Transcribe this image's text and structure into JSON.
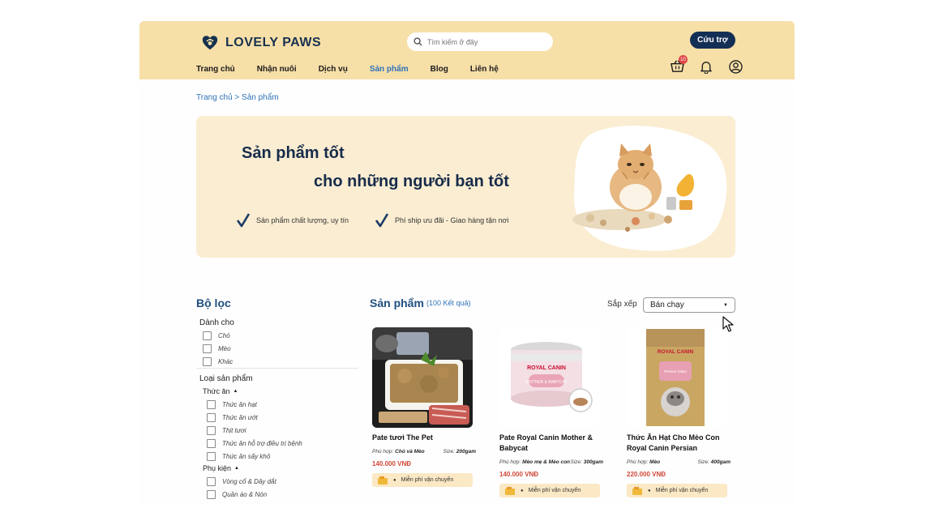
{
  "brand": {
    "name": "LOVELY PAWS"
  },
  "search": {
    "placeholder": "Tìm kiếm ở đây"
  },
  "header": {
    "support_label": "Cứu trợ",
    "cart_badge": "10"
  },
  "nav": [
    "Trang chủ",
    "Nhận nuôi",
    "Dịch vụ",
    "Sản phẩm",
    "Blog",
    "Liên hệ"
  ],
  "breadcrumb": "Trang chủ > Sản phẩm",
  "hero": {
    "line1": "Sản phẩm tốt",
    "line2": "cho những người bạn tốt",
    "feature1": "Sản phẩm chất lượng, uy tín",
    "feature2": "Phí ship ưu đãi - Giao hàng tận nơi"
  },
  "filter": {
    "title": "Bộ lọc",
    "for_title": "Dành cho",
    "for_options": [
      "Chó",
      "Mèo",
      "Khác"
    ],
    "type_title": "Loại sản phẩm",
    "food_title": "Thức ăn",
    "food_options": [
      "Thức ăn hạt",
      "Thức ăn ướt",
      "Thịt tươi",
      "Thức ăn hỗ trợ điều trị bệnh",
      "Thức ăn sấy khô"
    ],
    "accessory_title": "Phụ kiện",
    "accessory_options": [
      "Vòng cổ & Dây dắt",
      "Quần áo & Nón"
    ]
  },
  "products": {
    "title": "Sản phẩm",
    "count": "(100 Kết quả)",
    "sort_label": "Sắp xếp",
    "sort_value": "Bán chạy",
    "items": [
      {
        "name": "Pate tươi The Pet",
        "fit_label": "Phù hợp:",
        "fit": "Chó và Mèo",
        "size_label": "Size:",
        "size": "200gam",
        "price": "140.000 VNĐ",
        "shipping": "Miễn phí vận chuyển"
      },
      {
        "name": "Pate Royal Canin Mother & Babycat",
        "fit_label": "Phù hợp:",
        "fit": "Mèo mẹ & Mèo con",
        "size_label": "Size:",
        "size": "300gam",
        "price": "140.000 VNĐ",
        "shipping": "Miễn phí vận chuyển"
      },
      {
        "name": "Thức Ăn Hạt Cho Mèo Con Royal Canin Persian",
        "fit_label": "Phù hợp:",
        "fit": "Mèo",
        "size_label": "Size:",
        "size": "400gam",
        "price": "220.000 VNĐ",
        "shipping": "Miễn phí vận chuyển"
      }
    ]
  },
  "images": {
    "can_text": "MOTHER & BABYCAT",
    "brand_text": "ROYAL CANIN",
    "bag_text": "Persian Kitten"
  },
  "colors": {
    "header_bg": "#f7dfa8",
    "navy": "#142f55",
    "accent_blue": "#2e73b8",
    "price_red": "#d0483a",
    "hero_bg": "#fbedd2"
  }
}
